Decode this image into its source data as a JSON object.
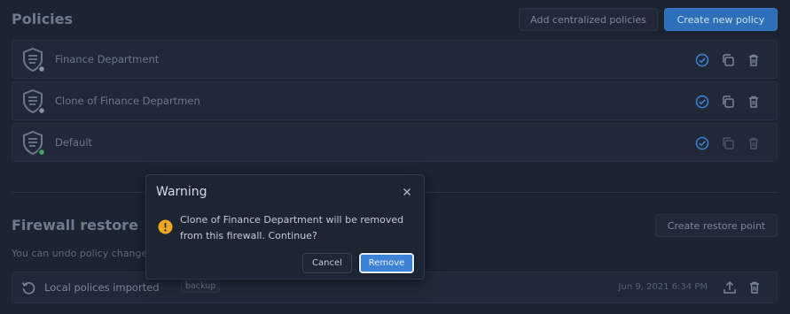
{
  "policies": {
    "title": "Policies",
    "add_centralized_label": "Add centralized policies",
    "create_new_label": "Create new policy",
    "items": [
      {
        "name": "Finance Department",
        "status_color": "#8a93a1"
      },
      {
        "name": "Clone of Finance Departmen",
        "status_color": "#8a93a1"
      },
      {
        "name": "Default",
        "status_color": "#49a65a"
      }
    ]
  },
  "restore": {
    "title": "Firewall restore",
    "create_point_label": "Create restore point",
    "description": "You can undo policy change",
    "row": {
      "label": "Local polices imported",
      "badge": "backup",
      "date": "Jun 9, 2021 6:34 PM"
    }
  },
  "modal": {
    "title": "Warning",
    "message": "Clone of Finance Department will be removed from this firewall. Continue?",
    "cancel_label": "Cancel",
    "remove_label": "Remove"
  },
  "colors": {
    "accent": "#3c82d6",
    "warning": "#f0a81e",
    "background": "#1c2331"
  }
}
